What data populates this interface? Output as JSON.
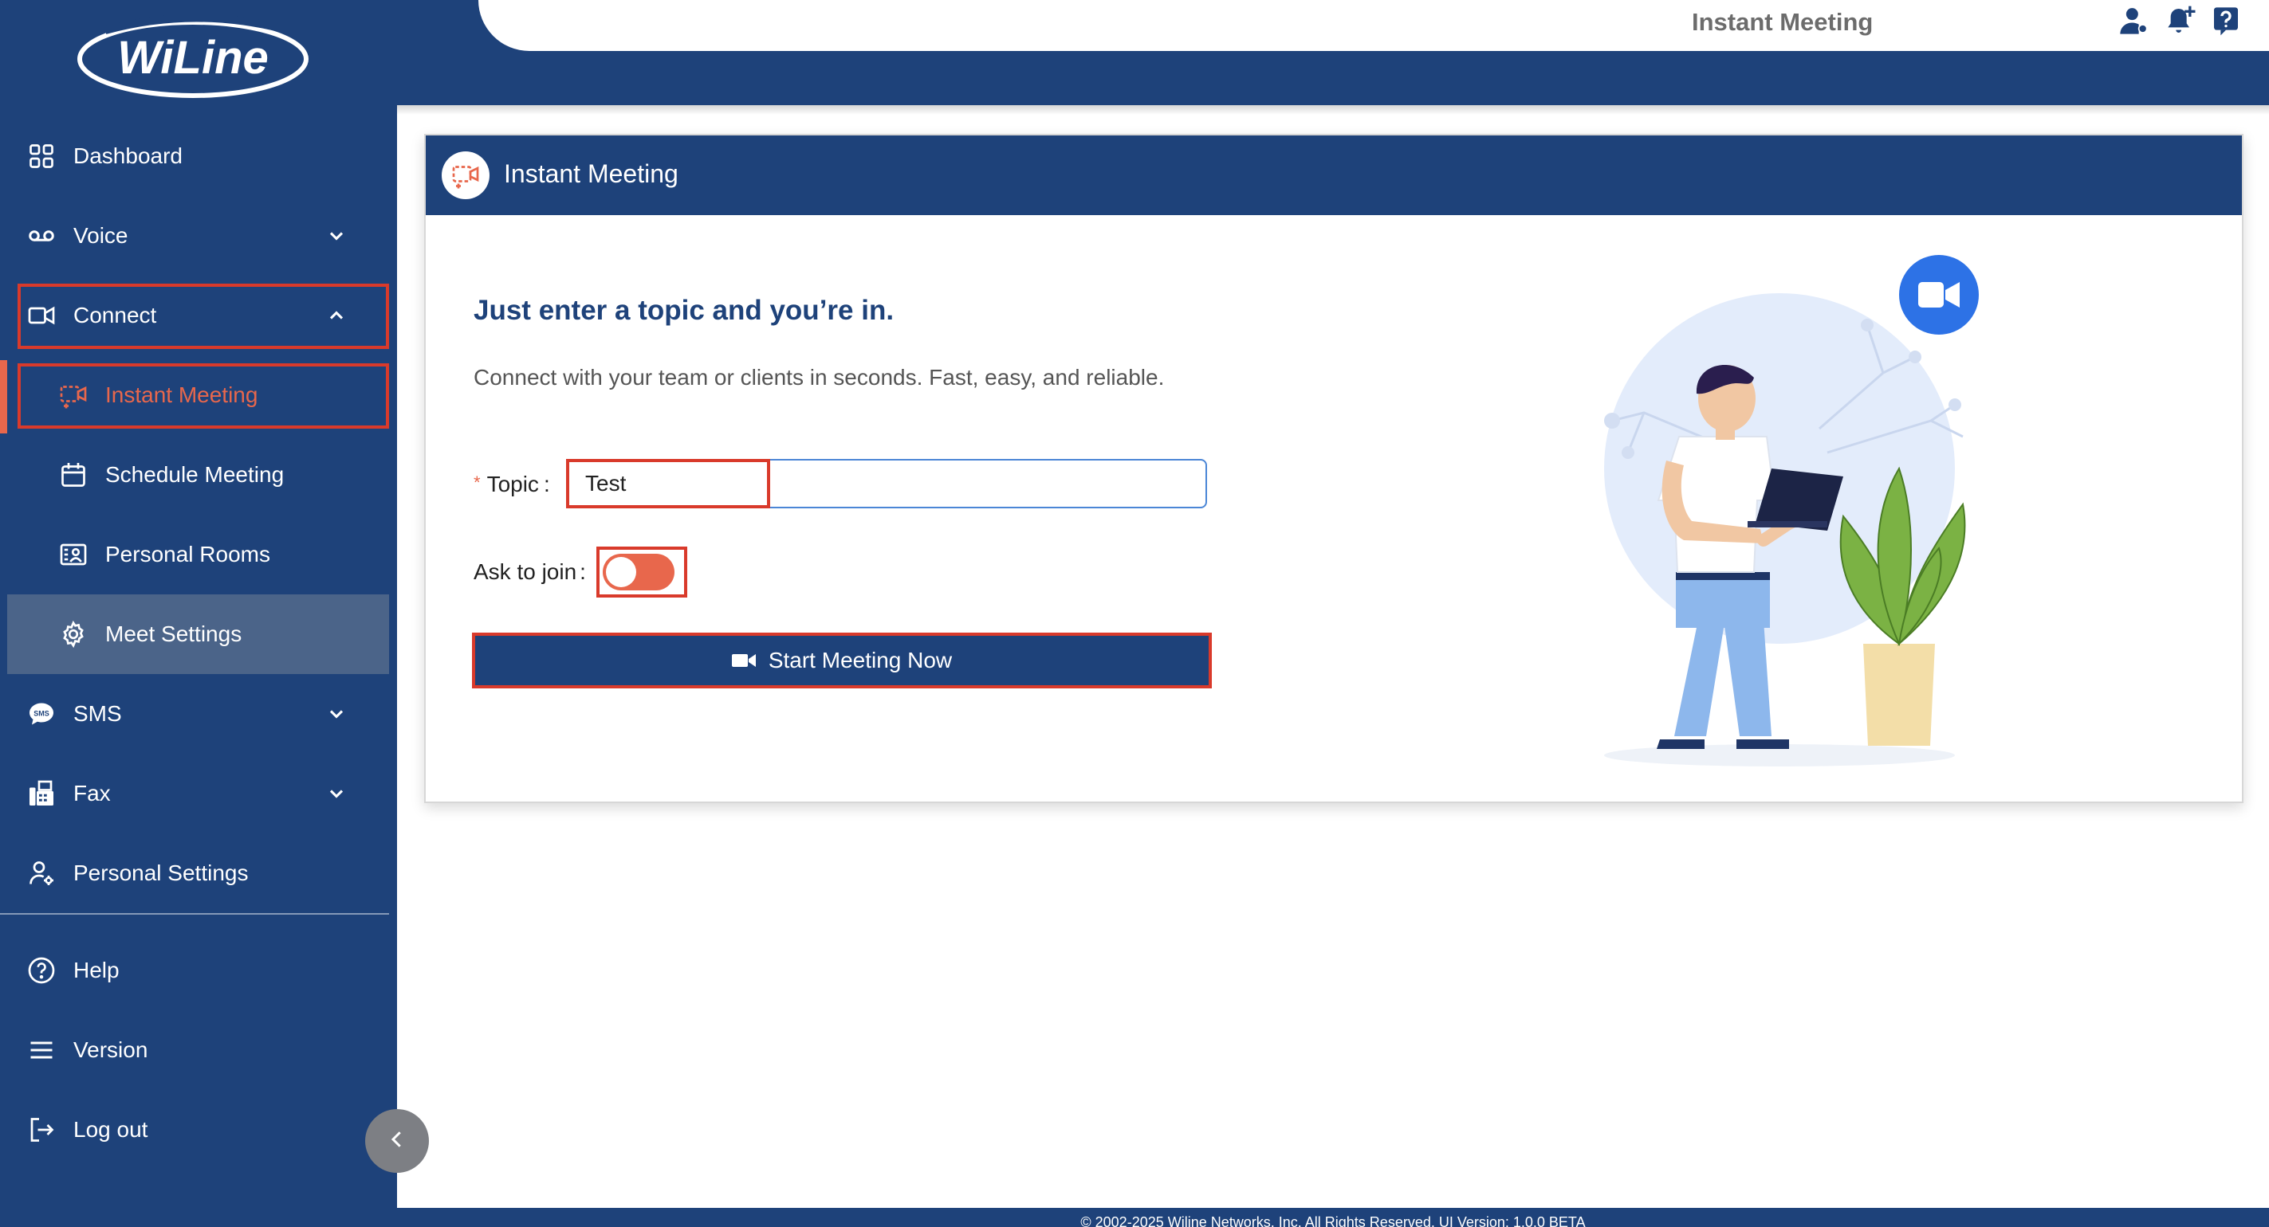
{
  "brand": {
    "logo_text": "WiLine",
    "accent": "#e8674c",
    "primary": "#1e427a"
  },
  "header": {
    "title": "Instant Meeting",
    "icons": [
      "user-icon",
      "bell-plus-icon",
      "help-icon"
    ]
  },
  "sidebar": {
    "items": [
      {
        "label": "Dashboard",
        "icon": "dashboard-icon"
      },
      {
        "label": "Voice",
        "icon": "voicemail-icon",
        "expandable": true
      },
      {
        "label": "Connect",
        "icon": "video-icon",
        "expanded": true
      },
      {
        "label": "Instant Meeting",
        "icon": "instant-meeting-icon",
        "active": true
      },
      {
        "label": "Schedule Meeting",
        "icon": "calendar-icon"
      },
      {
        "label": "Personal Rooms",
        "icon": "personal-rooms-icon"
      },
      {
        "label": "Meet Settings",
        "icon": "gear-icon"
      },
      {
        "label": "SMS",
        "icon": "sms-icon",
        "expandable": true
      },
      {
        "label": "Fax",
        "icon": "fax-icon",
        "expandable": true
      },
      {
        "label": "Personal Settings",
        "icon": "user-settings-icon"
      },
      {
        "label": "Help",
        "icon": "help-circle-icon"
      },
      {
        "label": "Version",
        "icon": "menu-icon"
      },
      {
        "label": "Log out",
        "icon": "logout-icon"
      }
    ]
  },
  "card": {
    "title": "Instant Meeting",
    "headline": "Just enter a topic and you’re in.",
    "subline": "Connect with your team or clients in seconds. Fast, easy, and reliable.",
    "topic_label": "Topic",
    "topic_required_mark": "*",
    "label_colon": ":",
    "topic_value": "Test",
    "ask_to_join_label": "Ask to join",
    "ask_to_join_enabled": false,
    "start_button_label": "Start Meeting Now"
  },
  "footer": {
    "text": "© 2002-2025 Wiline Networks, Inc. All Rights Reserved. UI Version: 1.0.0 BETA"
  }
}
